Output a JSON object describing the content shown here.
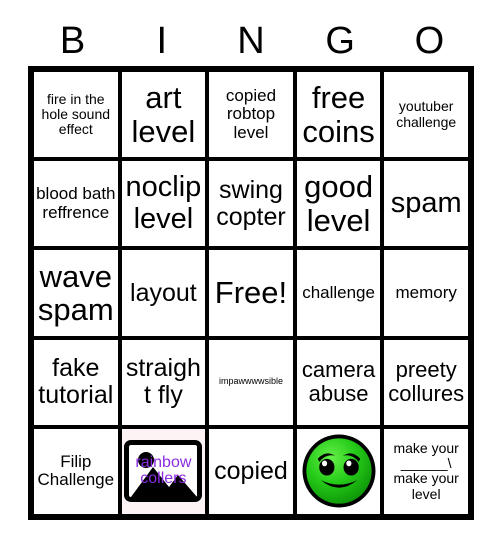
{
  "card": {
    "title": "BINGO",
    "header_letters": [
      "B",
      "I",
      "N",
      "G",
      "O"
    ],
    "background_color": "#ffffff",
    "border_color": "#000000",
    "rows": 5,
    "columns": 5
  },
  "cells": [
    [
      {
        "text": "fire in the hole sound effect",
        "size": "xs",
        "type": "text"
      },
      {
        "text": "art level",
        "size": "xxl",
        "type": "text"
      },
      {
        "text": "copied robtop level",
        "size": "sm",
        "type": "text"
      },
      {
        "text": "free coins",
        "size": "xxl",
        "type": "text"
      },
      {
        "text": "youtuber challenge",
        "size": "xs",
        "type": "text"
      }
    ],
    [
      {
        "text": "blood bath reffrence",
        "size": "sm",
        "type": "text"
      },
      {
        "text": "noclip level",
        "size": "xl",
        "type": "text"
      },
      {
        "text": "swing copter",
        "size": "lg",
        "type": "text"
      },
      {
        "text": "good level",
        "size": "xxl",
        "type": "text"
      },
      {
        "text": "spam",
        "size": "xl",
        "type": "text"
      }
    ],
    [
      {
        "text": "wave spam",
        "size": "xxl",
        "type": "text"
      },
      {
        "text": "layout",
        "size": "lg",
        "type": "text"
      },
      {
        "text": "Free!",
        "size": "xxl",
        "type": "text",
        "free_space": true
      },
      {
        "text": "challenge",
        "size": "sm",
        "type": "text"
      },
      {
        "text": "memory",
        "size": "sm",
        "type": "text"
      }
    ],
    [
      {
        "text": "fake tutorial",
        "size": "lg",
        "type": "text"
      },
      {
        "text": "straight fly",
        "size": "lg",
        "type": "text"
      },
      {
        "text": "impawwwwsible",
        "size": "xxs",
        "type": "text"
      },
      {
        "text": "camera abuse",
        "size": "md",
        "type": "text"
      },
      {
        "text": "preety collures",
        "size": "md",
        "type": "text"
      }
    ],
    [
      {
        "text": "Filip Challenge",
        "size": "sm",
        "type": "text"
      },
      {
        "text": "",
        "size": "sm",
        "type": "broken-image",
        "alt_text": "rainbow collers",
        "alt_color": "#8a2be2",
        "tinted": true
      },
      {
        "text": "copied",
        "size": "lg",
        "type": "text"
      },
      {
        "text": "",
        "size": "sm",
        "type": "gd-face-icon",
        "icon_color": "#19c419"
      },
      {
        "text": "make your ______\\ make your level",
        "size": "xs",
        "type": "text"
      }
    ]
  ]
}
